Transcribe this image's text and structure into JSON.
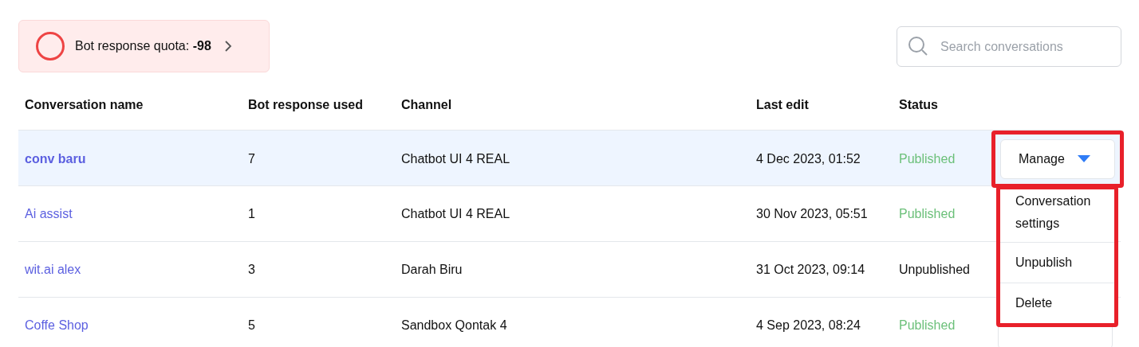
{
  "quota": {
    "label": "Bot response quota:",
    "value": "-98"
  },
  "search": {
    "placeholder": "Search conversations"
  },
  "table": {
    "columns": [
      "Conversation name",
      "Bot response used",
      "Channel",
      "Last edit",
      "Status"
    ],
    "rows": [
      {
        "name": "conv baru",
        "used": "7",
        "channel": "Chatbot UI 4 REAL",
        "last_edit": "4 Dec 2023, 01:52",
        "status": {
          "label": "Published",
          "kind": "published"
        },
        "selected": true,
        "action": {
          "label": "Manage",
          "open": true,
          "annotated": true
        }
      },
      {
        "name": "Ai assist",
        "used": "1",
        "channel": "Chatbot UI 4 REAL",
        "last_edit": "30 Nov 2023, 05:51",
        "status": {
          "label": "Published",
          "kind": "published"
        },
        "selected": false
      },
      {
        "name": "wit.ai alex",
        "used": "3",
        "channel": "Darah Biru",
        "last_edit": "31 Oct 2023, 09:14",
        "status": {
          "label": "Unpublished",
          "kind": "unpublished"
        },
        "selected": false
      },
      {
        "name": "Coffe Shop",
        "used": "5",
        "channel": "Sandbox Qontak 4",
        "last_edit": "4 Sep 2023, 08:24",
        "status": {
          "label": "Published",
          "kind": "published"
        },
        "selected": false,
        "action": {
          "open": false
        }
      }
    ]
  },
  "menu": {
    "annotated": true,
    "items": [
      "Conversation settings",
      "Unpublish",
      "Delete"
    ]
  }
}
